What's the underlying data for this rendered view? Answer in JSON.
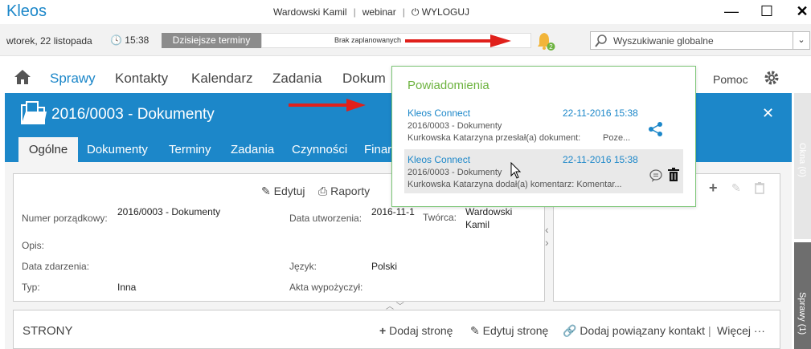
{
  "app": {
    "logo": "Kleos"
  },
  "topbar": {
    "user": "Wardowski Kamil",
    "env": "webinar",
    "logout": "WYLOGUJ",
    "minimize": "—",
    "maximize": "☐",
    "close": "✕"
  },
  "statusbar": {
    "date": "wtorek, 22 listopada",
    "time": "15:38",
    "todays_label": "Dzisiejsze terminy",
    "todays_value": "Brak zaplanowanych",
    "notif_count": "2",
    "search_placeholder": "Wyszukiwanie globalne"
  },
  "nav": {
    "items": [
      "Sprawy",
      "Kontakty",
      "Kalendarz",
      "Zadania",
      "Dokum"
    ],
    "help": "Pomoc"
  },
  "case": {
    "title": "2016/0003 - Dokumenty",
    "tabs": [
      "Ogólne",
      "Dokumenty",
      "Terminy",
      "Zadania",
      "Czynności",
      "Finar"
    ]
  },
  "side": {
    "okna": "Okna (0)",
    "sprawy": "Sprawy (1)"
  },
  "details": {
    "actions": {
      "edit": "Edytuj",
      "reports": "Raporty"
    },
    "fields": {
      "numer_label": "Numer porządkowy:",
      "numer_value": "2016/0003 - Dokumenty",
      "utworzenia_label": "Data utworzenia:",
      "utworzenia_value": "2016-11-1",
      "tworca_label": "Twórca:",
      "tworca_value_1": "Wardowski",
      "tworca_value_2": "Kamil",
      "opis_label": "Opis:",
      "zdarzenia_label": "Data zdarzenia:",
      "jezyk_label": "Język:",
      "jezyk_value": "Polski",
      "typ_label": "Typ:",
      "typ_value": "Inna",
      "akta_label": "Akta wypożyczył:"
    }
  },
  "strony": {
    "title": "STRONY",
    "add": "Dodaj stronę",
    "edit": "Edytuj stronę",
    "add_related": "Dodaj powiązany kontakt",
    "more": "Więcej"
  },
  "notifications": {
    "title": "Powiadomienia",
    "items": [
      {
        "source": "Kleos Connect",
        "date": "22-11-2016 15:38",
        "case": "2016/0003 - Dokumenty",
        "text": "Kurkowska Katarzyna przesłał(a) dokument:",
        "extra": "Poze..."
      },
      {
        "source": "Kleos Connect",
        "date": "22-11-2016 15:38",
        "case": "2016/0003 - Dokumenty",
        "text": "Kurkowska Katarzyna dodał(a) komentarz: Komentar..."
      }
    ]
  },
  "colors": {
    "brand": "#1c87c9",
    "accent_green": "#6db33f",
    "arrow_red": "#e0201b"
  }
}
